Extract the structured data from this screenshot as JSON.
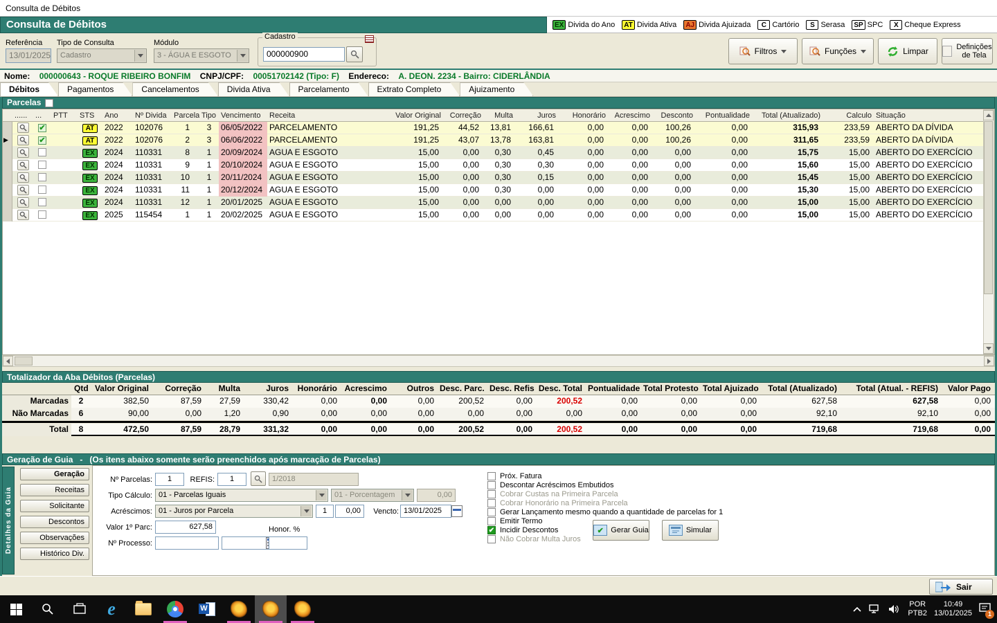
{
  "window": {
    "title": "Consulta de Débitos"
  },
  "header": {
    "title": "Consulta de Débitos",
    "legend": [
      {
        "code": "EX",
        "label": "Divida do Ano",
        "bg": "#3cb43c",
        "fg": "#003300"
      },
      {
        "code": "AT",
        "label": "Divida Ativa",
        "bg": "#ffff33",
        "fg": "#000000"
      },
      {
        "code": "AJ",
        "label": "Divida Ajuizada",
        "bg": "#e8772f",
        "fg": "#8b0000"
      },
      {
        "code": "C",
        "label": "Cartório",
        "bg": "#ffffff",
        "fg": "#000000"
      },
      {
        "code": "S",
        "label": "Serasa",
        "bg": "#ffffff",
        "fg": "#000000"
      },
      {
        "code": "SP",
        "label": "SPC",
        "bg": "#ffffff",
        "fg": "#000000"
      },
      {
        "code": "X",
        "label": "Cheque Express",
        "bg": "#ffffff",
        "fg": "#000000"
      }
    ]
  },
  "controls": {
    "referencia": {
      "label": "Referência",
      "value": "13/01/2025"
    },
    "tipo_consulta": {
      "label": "Tipo de Consulta",
      "value": "Cadastro"
    },
    "modulo": {
      "label": "Módulo",
      "value": "3 - ÁGUA E ESGOTO"
    },
    "cadastro": {
      "label": "Cadastro",
      "value": "000000900"
    },
    "filtros": "Filtros",
    "funcoes": "Funções",
    "limpar": "Limpar",
    "definicoes_line1": "Definições",
    "definicoes_line2": "de Tela"
  },
  "identification": {
    "nome_label": "Nome:",
    "nome_value": "000000643 - ROQUE RIBEIRO BONFIM",
    "cpf_label": "CNPJ/CPF:",
    "cpf_value": "00051702142 (Tipo: F)",
    "endereco_label": "Endereco:",
    "endereco_value": "A. DEON. 2234 - Bairro: CIDERLÂNDIA"
  },
  "tabs": [
    {
      "label": "Débitos",
      "active": true
    },
    {
      "label": "Pagamentos",
      "active": false
    },
    {
      "label": "Cancelamentos",
      "active": false
    },
    {
      "label": "Divida Ativa",
      "active": false
    },
    {
      "label": "Parcelamento",
      "active": false
    },
    {
      "label": "Extrato Completo",
      "active": false
    },
    {
      "label": "Ajuizamento",
      "active": false
    }
  ],
  "parcelas_bar": {
    "label": "Parcelas"
  },
  "debts_table": {
    "columns": [
      "......",
      "...",
      "PTT",
      "STS",
      "Ano",
      "Nº Divida",
      "Parcela",
      "Tipo",
      "Vencimento",
      "Receita",
      "Valor Original",
      "Correção",
      "Multa",
      "Juros",
      "Honorário",
      "Acrescimo",
      "Desconto",
      "Pontualidade",
      "Total (Atualizado)",
      "Calculo",
      "Situação"
    ],
    "rows": [
      {
        "current": false,
        "checked": true,
        "marked": true,
        "shaded": false,
        "sts": "AT",
        "ano": "2022",
        "divida": "102076",
        "parcela": "1",
        "tipo": "3",
        "venc": "06/05/2022",
        "venc_overdue": true,
        "receita": "PARCELAMENTO",
        "valor_original": "191,25",
        "correcao": "44,52",
        "multa": "13,81",
        "juros": "166,61",
        "honorario": "0,00",
        "acrescimo": "0,00",
        "desconto": "100,26",
        "pontualidade": "0,00",
        "total": "315,93",
        "calculo": "233,59",
        "situacao": "ABERTO DA DÍVIDA"
      },
      {
        "current": true,
        "checked": true,
        "marked": true,
        "shaded": false,
        "sts": "AT",
        "ano": "2022",
        "divida": "102076",
        "parcela": "2",
        "tipo": "3",
        "venc": "06/06/2022",
        "venc_overdue": true,
        "receita": "PARCELAMENTO",
        "valor_original": "191,25",
        "correcao": "43,07",
        "multa": "13,78",
        "juros": "163,81",
        "honorario": "0,00",
        "acrescimo": "0,00",
        "desconto": "100,26",
        "pontualidade": "0,00",
        "total": "311,65",
        "calculo": "233,59",
        "situacao": "ABERTO DA DÍVIDA"
      },
      {
        "current": false,
        "checked": false,
        "marked": false,
        "shaded": true,
        "sts": "EX",
        "ano": "2024",
        "divida": "110331",
        "parcela": "8",
        "tipo": "1",
        "venc": "20/09/2024",
        "venc_overdue": true,
        "receita": "AGUA E ESGOTO",
        "valor_original": "15,00",
        "correcao": "0,00",
        "multa": "0,30",
        "juros": "0,45",
        "honorario": "0,00",
        "acrescimo": "0,00",
        "desconto": "0,00",
        "pontualidade": "0,00",
        "total": "15,75",
        "calculo": "15,00",
        "situacao": "ABERTO DO EXERCÍCIO"
      },
      {
        "current": false,
        "checked": false,
        "marked": false,
        "shaded": false,
        "sts": "EX",
        "ano": "2024",
        "divida": "110331",
        "parcela": "9",
        "tipo": "1",
        "venc": "20/10/2024",
        "venc_overdue": true,
        "receita": "AGUA E ESGOTO",
        "valor_original": "15,00",
        "correcao": "0,00",
        "multa": "0,30",
        "juros": "0,30",
        "honorario": "0,00",
        "acrescimo": "0,00",
        "desconto": "0,00",
        "pontualidade": "0,00",
        "total": "15,60",
        "calculo": "15,00",
        "situacao": "ABERTO DO EXERCÍCIO"
      },
      {
        "current": false,
        "checked": false,
        "marked": false,
        "shaded": true,
        "sts": "EX",
        "ano": "2024",
        "divida": "110331",
        "parcela": "10",
        "tipo": "1",
        "venc": "20/11/2024",
        "venc_overdue": true,
        "receita": "AGUA E ESGOTO",
        "valor_original": "15,00",
        "correcao": "0,00",
        "multa": "0,30",
        "juros": "0,15",
        "honorario": "0,00",
        "acrescimo": "0,00",
        "desconto": "0,00",
        "pontualidade": "0,00",
        "total": "15,45",
        "calculo": "15,00",
        "situacao": "ABERTO DO EXERCÍCIO"
      },
      {
        "current": false,
        "checked": false,
        "marked": false,
        "shaded": false,
        "sts": "EX",
        "ano": "2024",
        "divida": "110331",
        "parcela": "11",
        "tipo": "1",
        "venc": "20/12/2024",
        "venc_overdue": true,
        "receita": "AGUA E ESGOTO",
        "valor_original": "15,00",
        "correcao": "0,00",
        "multa": "0,30",
        "juros": "0,00",
        "honorario": "0,00",
        "acrescimo": "0,00",
        "desconto": "0,00",
        "pontualidade": "0,00",
        "total": "15,30",
        "calculo": "15,00",
        "situacao": "ABERTO DO EXERCÍCIO"
      },
      {
        "current": false,
        "checked": false,
        "marked": false,
        "shaded": true,
        "sts": "EX",
        "ano": "2024",
        "divida": "110331",
        "parcela": "12",
        "tipo": "1",
        "venc": "20/01/2025",
        "venc_overdue": false,
        "receita": "AGUA E ESGOTO",
        "valor_original": "15,00",
        "correcao": "0,00",
        "multa": "0,00",
        "juros": "0,00",
        "honorario": "0,00",
        "acrescimo": "0,00",
        "desconto": "0,00",
        "pontualidade": "0,00",
        "total": "15,00",
        "calculo": "15,00",
        "situacao": "ABERTO DO EXERCÍCIO"
      },
      {
        "current": false,
        "checked": false,
        "marked": false,
        "shaded": false,
        "sts": "EX",
        "ano": "2025",
        "divida": "115454",
        "parcela": "1",
        "tipo": "1",
        "venc": "20/02/2025",
        "venc_overdue": false,
        "receita": "AGUA E ESGOTO",
        "valor_original": "15,00",
        "correcao": "0,00",
        "multa": "0,00",
        "juros": "0,00",
        "honorario": "0,00",
        "acrescimo": "0,00",
        "desconto": "0,00",
        "pontualidade": "0,00",
        "total": "15,00",
        "calculo": "15,00",
        "situacao": "ABERTO DO EXERCÍCIO"
      }
    ]
  },
  "totalizer": {
    "title": "Totalizador da Aba Débitos (Parcelas)",
    "columns": [
      "",
      "Qtd",
      "Valor Original",
      "Correção",
      "Multa",
      "Juros",
      "Honorário",
      "Acrescimo",
      "Outros",
      "Desc. Parc.",
      "Desc. Refis",
      "Desc. Total",
      "Pontualidade",
      "Total Protesto",
      "Total Ajuizado",
      "Total (Atualizado)",
      "Total (Atual. - REFIS)",
      "Valor Pago"
    ],
    "rows": [
      {
        "label": "Marcadas",
        "emph": true,
        "values": [
          "2",
          "382,50",
          "87,59",
          "27,59",
          "330,42",
          "0,00",
          "0,00",
          "0,00",
          "200,52",
          "0,00",
          "200,52",
          "0,00",
          "0,00",
          "0,00",
          "627,58",
          "627,58",
          "0,00"
        ]
      },
      {
        "label": "Não Marcadas",
        "emph": false,
        "values": [
          "6",
          "90,00",
          "0,00",
          "1,20",
          "0,90",
          "0,00",
          "0,00",
          "0,00",
          "0,00",
          "0,00",
          "0,00",
          "0,00",
          "0,00",
          "0,00",
          "92,10",
          "92,10",
          "0,00"
        ]
      },
      {
        "label": "Total",
        "emph": true,
        "values": [
          "8",
          "472,50",
          "87,59",
          "28,79",
          "331,32",
          "0,00",
          "0,00",
          "0,00",
          "200,52",
          "0,00",
          "200,52",
          "0,00",
          "0,00",
          "0,00",
          "719,68",
          "719,68",
          "0,00"
        ]
      }
    ]
  },
  "guia": {
    "title": "Geração de Guia",
    "title_sep": "-",
    "note": "(Os itens abaixo somente serão preenchidos após marcação de Parcelas)",
    "side_strip": "Detalhes da Guia",
    "side_buttons": [
      {
        "label": "Geração",
        "active": true
      },
      {
        "label": "Receitas",
        "active": false
      },
      {
        "label": "Solicitante",
        "active": false
      },
      {
        "label": "Descontos",
        "active": false
      },
      {
        "label": "Observações",
        "active": false
      },
      {
        "label": "Histórico Div.",
        "active": false
      }
    ],
    "fields": {
      "n_parcelas_label": "Nº Parcelas:",
      "n_parcelas_value": "1",
      "refis_label": "REFIS:",
      "refis_value": "1",
      "refis_ref": "1/2018",
      "tipo_calculo_label": "Tipo Cálculo:",
      "tipo_calculo_value": "01 - Parcelas Iguais",
      "porcentagem_value": "01 - Porcentagem",
      "porcentagem_num": "0,00",
      "acrescimos_label": "Acréscimos:",
      "acrescimos_value": "01 - Juros por Parcela",
      "acrescimos_qty": "1",
      "acrescimos_num": "0,00",
      "vencto_label": "Vencto:",
      "vencto_value": "13/01/2025",
      "valor_parc_label": "Valor 1º Parc:",
      "valor_parc_value": "627,58",
      "processo_label": "Nº Processo:",
      "honor_label": "Honor. %"
    },
    "checkboxes": [
      {
        "label": "Próx. Fatura",
        "checked": false,
        "disabled": false
      },
      {
        "label": "Descontar Acréscimos Embutidos",
        "checked": false,
        "disabled": false
      },
      {
        "label": "Cobrar Custas na Primeira Parcela",
        "checked": false,
        "disabled": true
      },
      {
        "label": "Cobrar Honorário na Primeira Parcela",
        "checked": false,
        "disabled": true
      },
      {
        "label": "Gerar Lançamento mesmo quando a quantidade de parcelas for 1",
        "checked": false,
        "disabled": false
      },
      {
        "label": "Emitir Termo",
        "checked": false,
        "disabled": false
      },
      {
        "label": "Incidir Descontos",
        "checked": true,
        "disabled": false
      },
      {
        "label": "Não Cobrar Multa Juros",
        "checked": false,
        "disabled": true
      }
    ],
    "gerar_guia": "Gerar Guia",
    "simular": "Simular"
  },
  "footer": {
    "sair": "Sair"
  },
  "taskbar": {
    "lang_top": "POR",
    "lang_bottom": "PTB2",
    "time": "10:49",
    "date": "13/01/2025",
    "notification_badge": "1"
  }
}
